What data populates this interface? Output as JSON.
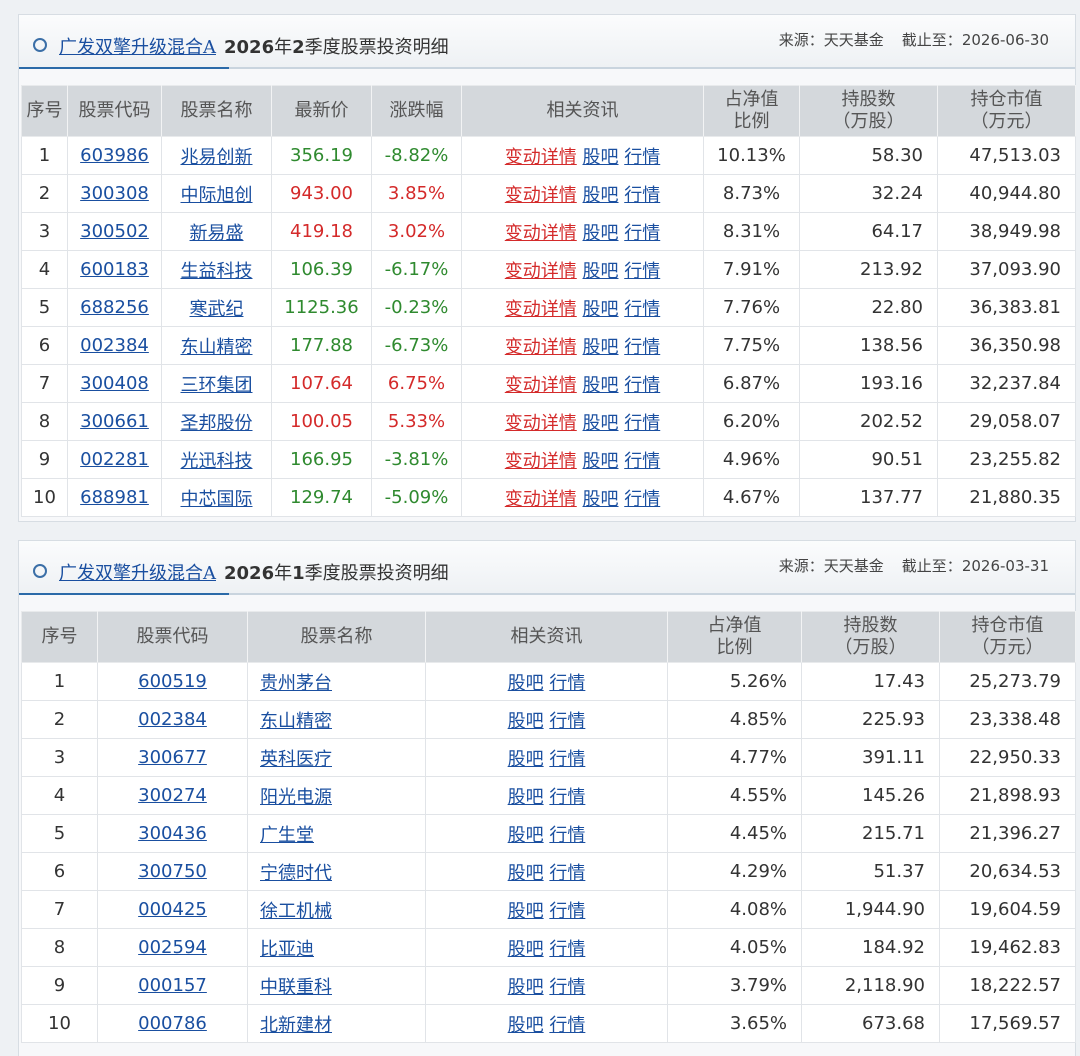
{
  "panels": [
    {
      "fund_name": "广发双擎升级混合A",
      "title_suffix_year": "2026",
      "title_suffix_mid": "年",
      "title_suffix_q": "2",
      "title_suffix_end": "季度股票投资明细",
      "source_label": "来源：天天基金",
      "as_of_label": "截止至：",
      "as_of_date": "2026-06-30",
      "headers": [
        "序号",
        "股票代码",
        "股票名称",
        "最新价",
        "涨跌幅",
        "相关资讯",
        "占净值比例",
        "持股数（万股）",
        "持仓市值（万元）"
      ],
      "rows": [
        {
          "no": "1",
          "code": "603986",
          "name": "兆易创新",
          "price": "356.19",
          "change": "-8.82%",
          "dir": "down",
          "pct": "10.13%",
          "shares": "58.30",
          "value": "47,513.03"
        },
        {
          "no": "2",
          "code": "300308",
          "name": "中际旭创",
          "price": "943.00",
          "change": "3.85%",
          "dir": "up",
          "pct": "8.73%",
          "shares": "32.24",
          "value": "40,944.80"
        },
        {
          "no": "3",
          "code": "300502",
          "name": "新易盛",
          "price": "419.18",
          "change": "3.02%",
          "dir": "up",
          "pct": "8.31%",
          "shares": "64.17",
          "value": "38,949.98"
        },
        {
          "no": "4",
          "code": "600183",
          "name": "生益科技",
          "price": "106.39",
          "change": "-6.17%",
          "dir": "down",
          "pct": "7.91%",
          "shares": "213.92",
          "value": "37,093.90"
        },
        {
          "no": "5",
          "code": "688256",
          "name": "寒武纪",
          "price": "1125.36",
          "change": "-0.23%",
          "dir": "down",
          "pct": "7.76%",
          "shares": "22.80",
          "value": "36,383.81"
        },
        {
          "no": "6",
          "code": "002384",
          "name": "东山精密",
          "price": "177.88",
          "change": "-6.73%",
          "dir": "down",
          "pct": "7.75%",
          "shares": "138.56",
          "value": "36,350.98"
        },
        {
          "no": "7",
          "code": "300408",
          "name": "三环集团",
          "price": "107.64",
          "change": "6.75%",
          "dir": "up",
          "pct": "6.87%",
          "shares": "193.16",
          "value": "32,237.84"
        },
        {
          "no": "8",
          "code": "300661",
          "name": "圣邦股份",
          "price": "100.05",
          "change": "5.33%",
          "dir": "up",
          "pct": "6.20%",
          "shares": "202.52",
          "value": "29,058.07"
        },
        {
          "no": "9",
          "code": "002281",
          "name": "光迅科技",
          "price": "166.95",
          "change": "-3.81%",
          "dir": "down",
          "pct": "4.96%",
          "shares": "90.51",
          "value": "23,255.82"
        },
        {
          "no": "10",
          "code": "688981",
          "name": "中芯国际",
          "price": "129.74",
          "change": "-5.09%",
          "dir": "down",
          "pct": "4.67%",
          "shares": "137.77",
          "value": "21,880.35"
        }
      ]
    },
    {
      "fund_name": "广发双擎升级混合A",
      "title_suffix_year": "2026",
      "title_suffix_mid": "年",
      "title_suffix_q": "1",
      "title_suffix_end": "季度股票投资明细",
      "source_label": "来源：天天基金",
      "as_of_label": "截止至：",
      "as_of_date": "2026-03-31",
      "headers": [
        "序号",
        "股票代码",
        "股票名称",
        "相关资讯",
        "占净值比例",
        "持股数（万股）",
        "持仓市值（万元）"
      ],
      "rows": [
        {
          "no": "1",
          "code": "600519",
          "name": "贵州茅台",
          "pct": "5.26%",
          "shares": "17.43",
          "value": "25,273.79"
        },
        {
          "no": "2",
          "code": "002384",
          "name": "东山精密",
          "pct": "4.85%",
          "shares": "225.93",
          "value": "23,338.48"
        },
        {
          "no": "3",
          "code": "300677",
          "name": "英科医疗",
          "pct": "4.77%",
          "shares": "391.11",
          "value": "22,950.33"
        },
        {
          "no": "4",
          "code": "300274",
          "name": "阳光电源",
          "pct": "4.55%",
          "shares": "145.26",
          "value": "21,898.93"
        },
        {
          "no": "5",
          "code": "300436",
          "name": "广生堂",
          "pct": "4.45%",
          "shares": "215.71",
          "value": "21,396.27"
        },
        {
          "no": "6",
          "code": "300750",
          "name": "宁德时代",
          "pct": "4.29%",
          "shares": "51.37",
          "value": "20,634.53"
        },
        {
          "no": "7",
          "code": "000425",
          "name": "徐工机械",
          "pct": "4.08%",
          "shares": "1,944.90",
          "value": "19,604.59"
        },
        {
          "no": "8",
          "code": "002594",
          "name": "比亚迪",
          "pct": "4.05%",
          "shares": "184.92",
          "value": "19,462.83"
        },
        {
          "no": "9",
          "code": "000157",
          "name": "中联重科",
          "pct": "3.79%",
          "shares": "2,118.90",
          "value": "18,222.57"
        },
        {
          "no": "10",
          "code": "000786",
          "name": "北新建材",
          "pct": "3.65%",
          "shares": "673.68",
          "value": "17,569.57"
        }
      ]
    }
  ],
  "links": {
    "detail": "变动详情",
    "guba": "股吧",
    "quote": "行情"
  },
  "header_split": {
    "pct_line1": "占净值",
    "pct_line2": "比例",
    "shares_line1": "持股数",
    "shares_line2": "（万股）",
    "value_line1": "持仓市值",
    "value_line2": "（万元）"
  },
  "colors": {
    "up": "#d42a2a",
    "down": "#2f8a2f",
    "link": "#1a4fa0"
  }
}
